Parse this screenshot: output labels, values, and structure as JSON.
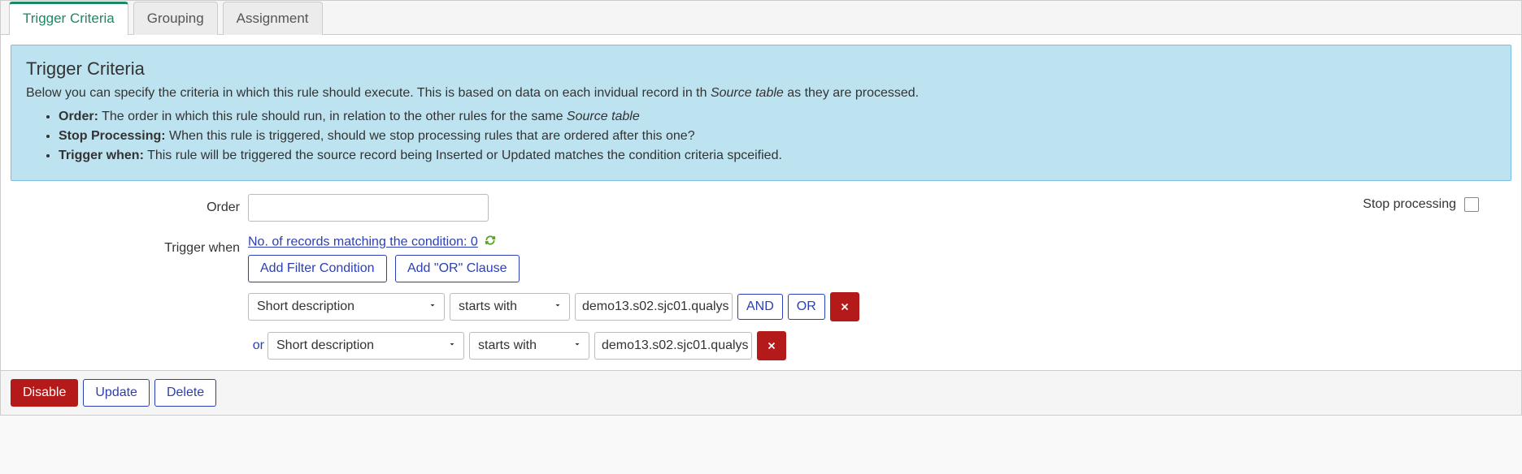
{
  "tabs": [
    {
      "label": "Trigger Criteria",
      "active": true
    },
    {
      "label": "Grouping",
      "active": false
    },
    {
      "label": "Assignment",
      "active": false
    }
  ],
  "info": {
    "title": "Trigger Criteria",
    "intro_pre": "Below you can specify the criteria in which this rule should execute. This is based on data on each invidual record in th ",
    "intro_em": "Source table",
    "intro_post": " as they are processed.",
    "bullets": [
      {
        "label": "Order:",
        "text_pre": " The order in which this rule should run, in relation to the other rules for the same ",
        "em": "Source table",
        "text_post": ""
      },
      {
        "label": "Stop Processing:",
        "text_pre": " When this rule is triggered, should we stop processing rules that are ordered after this one?",
        "em": "",
        "text_post": ""
      },
      {
        "label": "Trigger when:",
        "text_pre": " This rule will be triggered the source record being Inserted or Updated matches the condition criteria spceified.",
        "em": "",
        "text_post": ""
      }
    ]
  },
  "form": {
    "order_label": "Order",
    "order_value": "",
    "stop_label": "Stop processing",
    "stop_checked": false,
    "trigger_label": "Trigger when",
    "records_link": "No. of records matching the condition: 0",
    "add_filter_btn": "Add Filter Condition",
    "add_or_btn": "Add \"OR\" Clause",
    "and_btn": "AND",
    "or_btn": "OR",
    "or_row_label": "or",
    "conditions": [
      {
        "field": "Short description",
        "op": "starts with",
        "value": "demo13.s02.sjc01.qualys",
        "show_and_or": true
      },
      {
        "field": "Short description",
        "op": "starts with",
        "value": "demo13.s02.sjc01.qualys",
        "show_and_or": false
      }
    ]
  },
  "footer": {
    "disable": "Disable",
    "update": "Update",
    "delete": "Delete"
  }
}
